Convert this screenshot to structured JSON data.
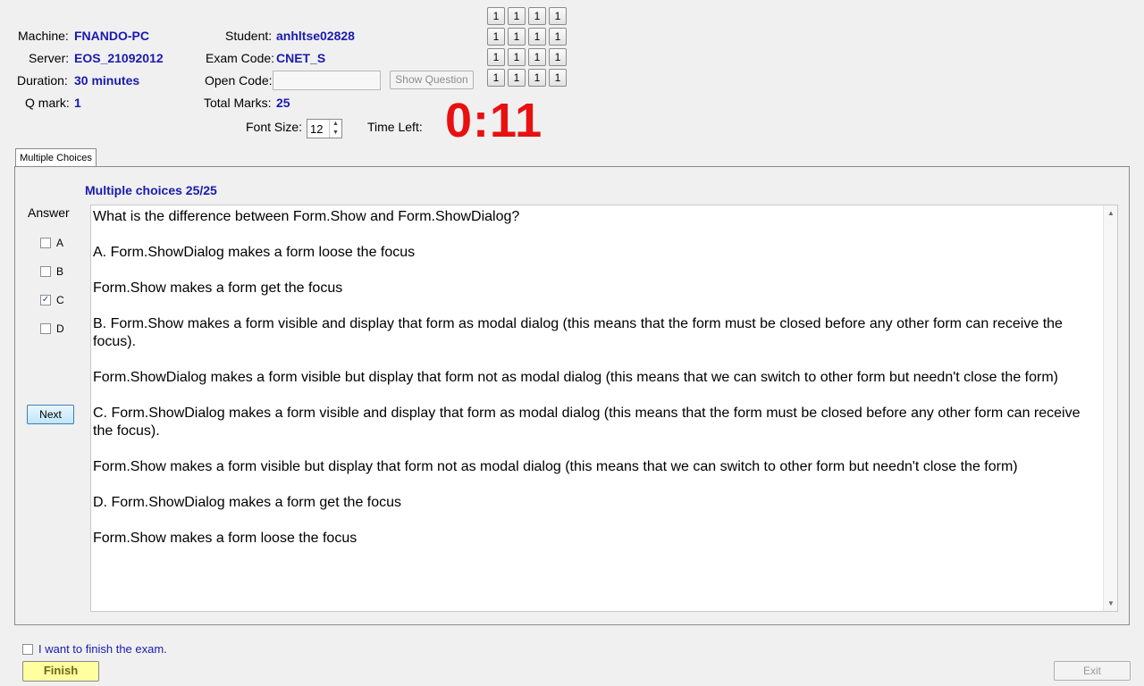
{
  "info": {
    "machine_label": "Machine:",
    "machine_value": "FNANDO-PC",
    "server_label": "Server:",
    "server_value": "EOS_21092012",
    "duration_label": "Duration:",
    "duration_value": "30 minutes",
    "qmark_label": "Q mark:",
    "qmark_value": "1",
    "student_label": "Student:",
    "student_value": "anhltse02828",
    "examcode_label": "Exam Code:",
    "examcode_value": "CNET_S",
    "opencode_label": "Open Code:",
    "opencode_value": "",
    "totalmarks_label": "Total Marks:",
    "totalmarks_value": "25",
    "show_question_label": "Show Question"
  },
  "font_size": {
    "label": "Font Size:",
    "value": "12"
  },
  "timer": {
    "label": "Time Left:",
    "value": "0:11"
  },
  "grid_buttons": [
    "1",
    "1",
    "1",
    "1",
    "1",
    "1",
    "1",
    "1",
    "1",
    "1",
    "1",
    "1",
    "1",
    "1",
    "1",
    "1"
  ],
  "tab_label": "Multiple Choices",
  "section_header": "Multiple choices 25/25",
  "answer": {
    "label": "Answer",
    "options": [
      {
        "label": "A",
        "checked": false
      },
      {
        "label": "B",
        "checked": false
      },
      {
        "label": "C",
        "checked": true
      },
      {
        "label": "D",
        "checked": false
      }
    ],
    "next_label": "Next"
  },
  "question": {
    "lines": [
      "What is the difference between Form.Show and Form.ShowDialog?",
      "A.  Form.ShowDialog makes a form loose the focus",
      "Form.Show makes a form get the focus",
      "B.  Form.Show makes a form visible and display that form as modal dialog (this means that the form must be closed before any other form can receive the focus).",
      "Form.ShowDialog makes a form visible but display that form not as modal dialog (this means that we can switch to other form but needn't close the form)",
      "C.  Form.ShowDialog makes a form visible and display that form as modal dialog (this means that the form must be closed before any other form can receive the focus).",
      "Form.Show makes a form visible but display that form not as modal dialog (this means that we can switch to other form but needn't close the form)",
      "D.  Form.ShowDialog makes a form get the focus",
      "Form.Show makes a form loose the focus"
    ]
  },
  "footer": {
    "finish_checkbox_label": "I want to finish the exam.",
    "finish_checked": false,
    "finish_label": "Finish",
    "exit_label": "Exit"
  },
  "colors": {
    "value_blue": "#1a1ab0",
    "timer_red": "#e81010",
    "finish_yellow": "#ffffa0"
  }
}
